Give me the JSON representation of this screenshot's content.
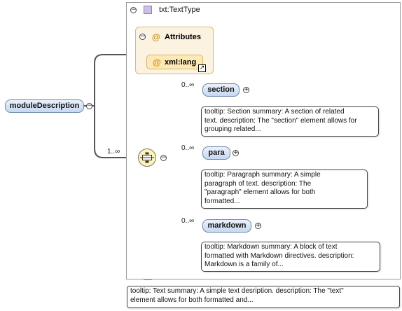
{
  "root": {
    "label": "moduleDescription"
  },
  "type": {
    "title": "txt:TextType"
  },
  "attributes": {
    "title": "Attributes",
    "items": [
      {
        "label": "xml:lang"
      }
    ]
  },
  "main_occurrence": "1..∞",
  "children": [
    {
      "label": "section",
      "occurrence": "0..∞",
      "tooltip": [
        "tooltip: Section summary: A section of related",
        "text. description: The \"section\" element allows for",
        "grouping related..."
      ]
    },
    {
      "label": "para",
      "occurrence": "0..∞",
      "tooltip": [
        "tooltip: Paragraph summary: A simple",
        "paragraph of text. description: The",
        "\"paragraph\" element allows for both",
        "formatted..."
      ]
    },
    {
      "label": "markdown",
      "occurrence": "0..∞",
      "tooltip": [
        "tooltip: Markdown summary: A block of text",
        "formatted with Markdown directives. description:",
        "Markdown is a family of..."
      ]
    }
  ],
  "type_tooltip": [
    "tooltip: Text summary: A simple text desription. description: The \"text\"",
    "element allows for both formatted and..."
  ]
}
